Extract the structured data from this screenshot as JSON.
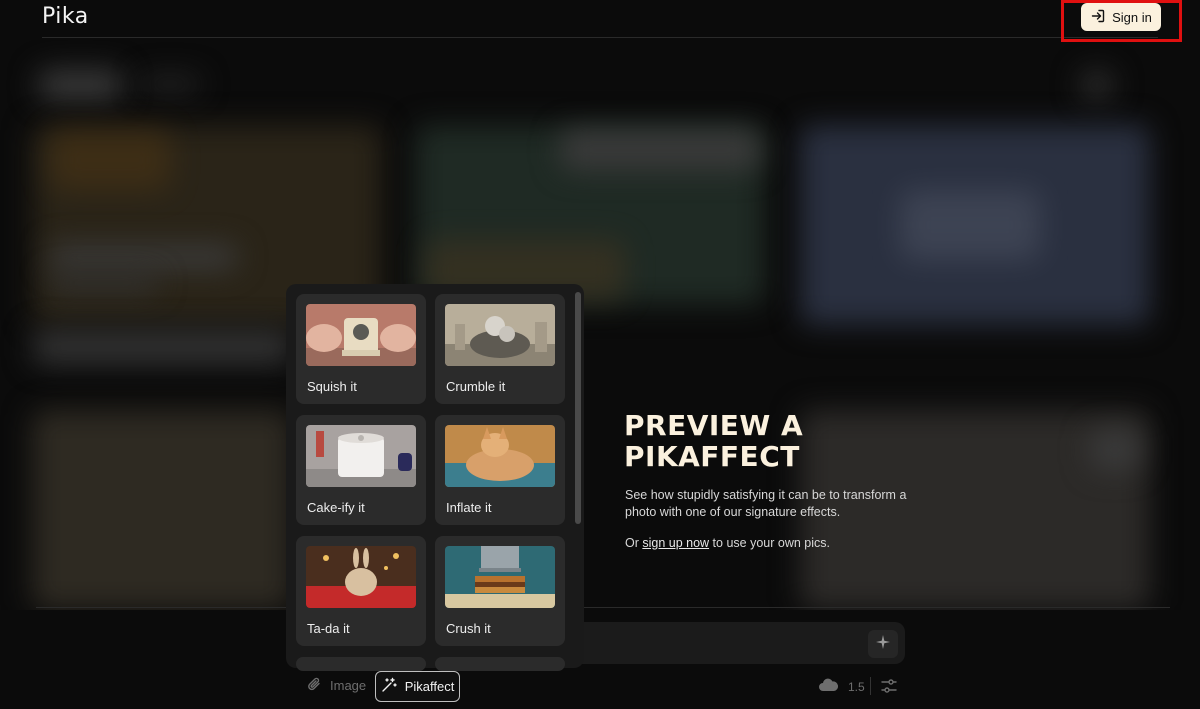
{
  "header": {
    "logo": "Pika",
    "signin_label": "Sign in",
    "signin_icon": "login-arrow-icon"
  },
  "effects": [
    {
      "label": "Squish it",
      "icon": "squish-thumbnail"
    },
    {
      "label": "Crumble it",
      "icon": "crumble-thumbnail"
    },
    {
      "label": "Cake-ify it",
      "icon": "cakeify-thumbnail"
    },
    {
      "label": "Inflate it",
      "icon": "inflate-thumbnail"
    },
    {
      "label": "Ta-da it",
      "icon": "tada-thumbnail"
    },
    {
      "label": "Crush it",
      "icon": "crush-thumbnail"
    }
  ],
  "preview": {
    "title_line1": "PREVIEW A",
    "title_line2": "PIKAFFECT",
    "description": "See how stupidly satisfying it can be to transform a photo with one of our signature effects.",
    "cta_prefix": "Or ",
    "cta_link": "sign up now",
    "cta_suffix": " to use your own pics."
  },
  "toolbar": {
    "image_label": "Image",
    "pikaffect_label": "Pikaffect",
    "credits_value": "1.5"
  },
  "colors": {
    "background": "#0b0b0b",
    "accent_cream": "#fbf1de",
    "highlight_red": "#e01010",
    "panel": "#1a1a1a",
    "card": "#2b2b2b"
  }
}
